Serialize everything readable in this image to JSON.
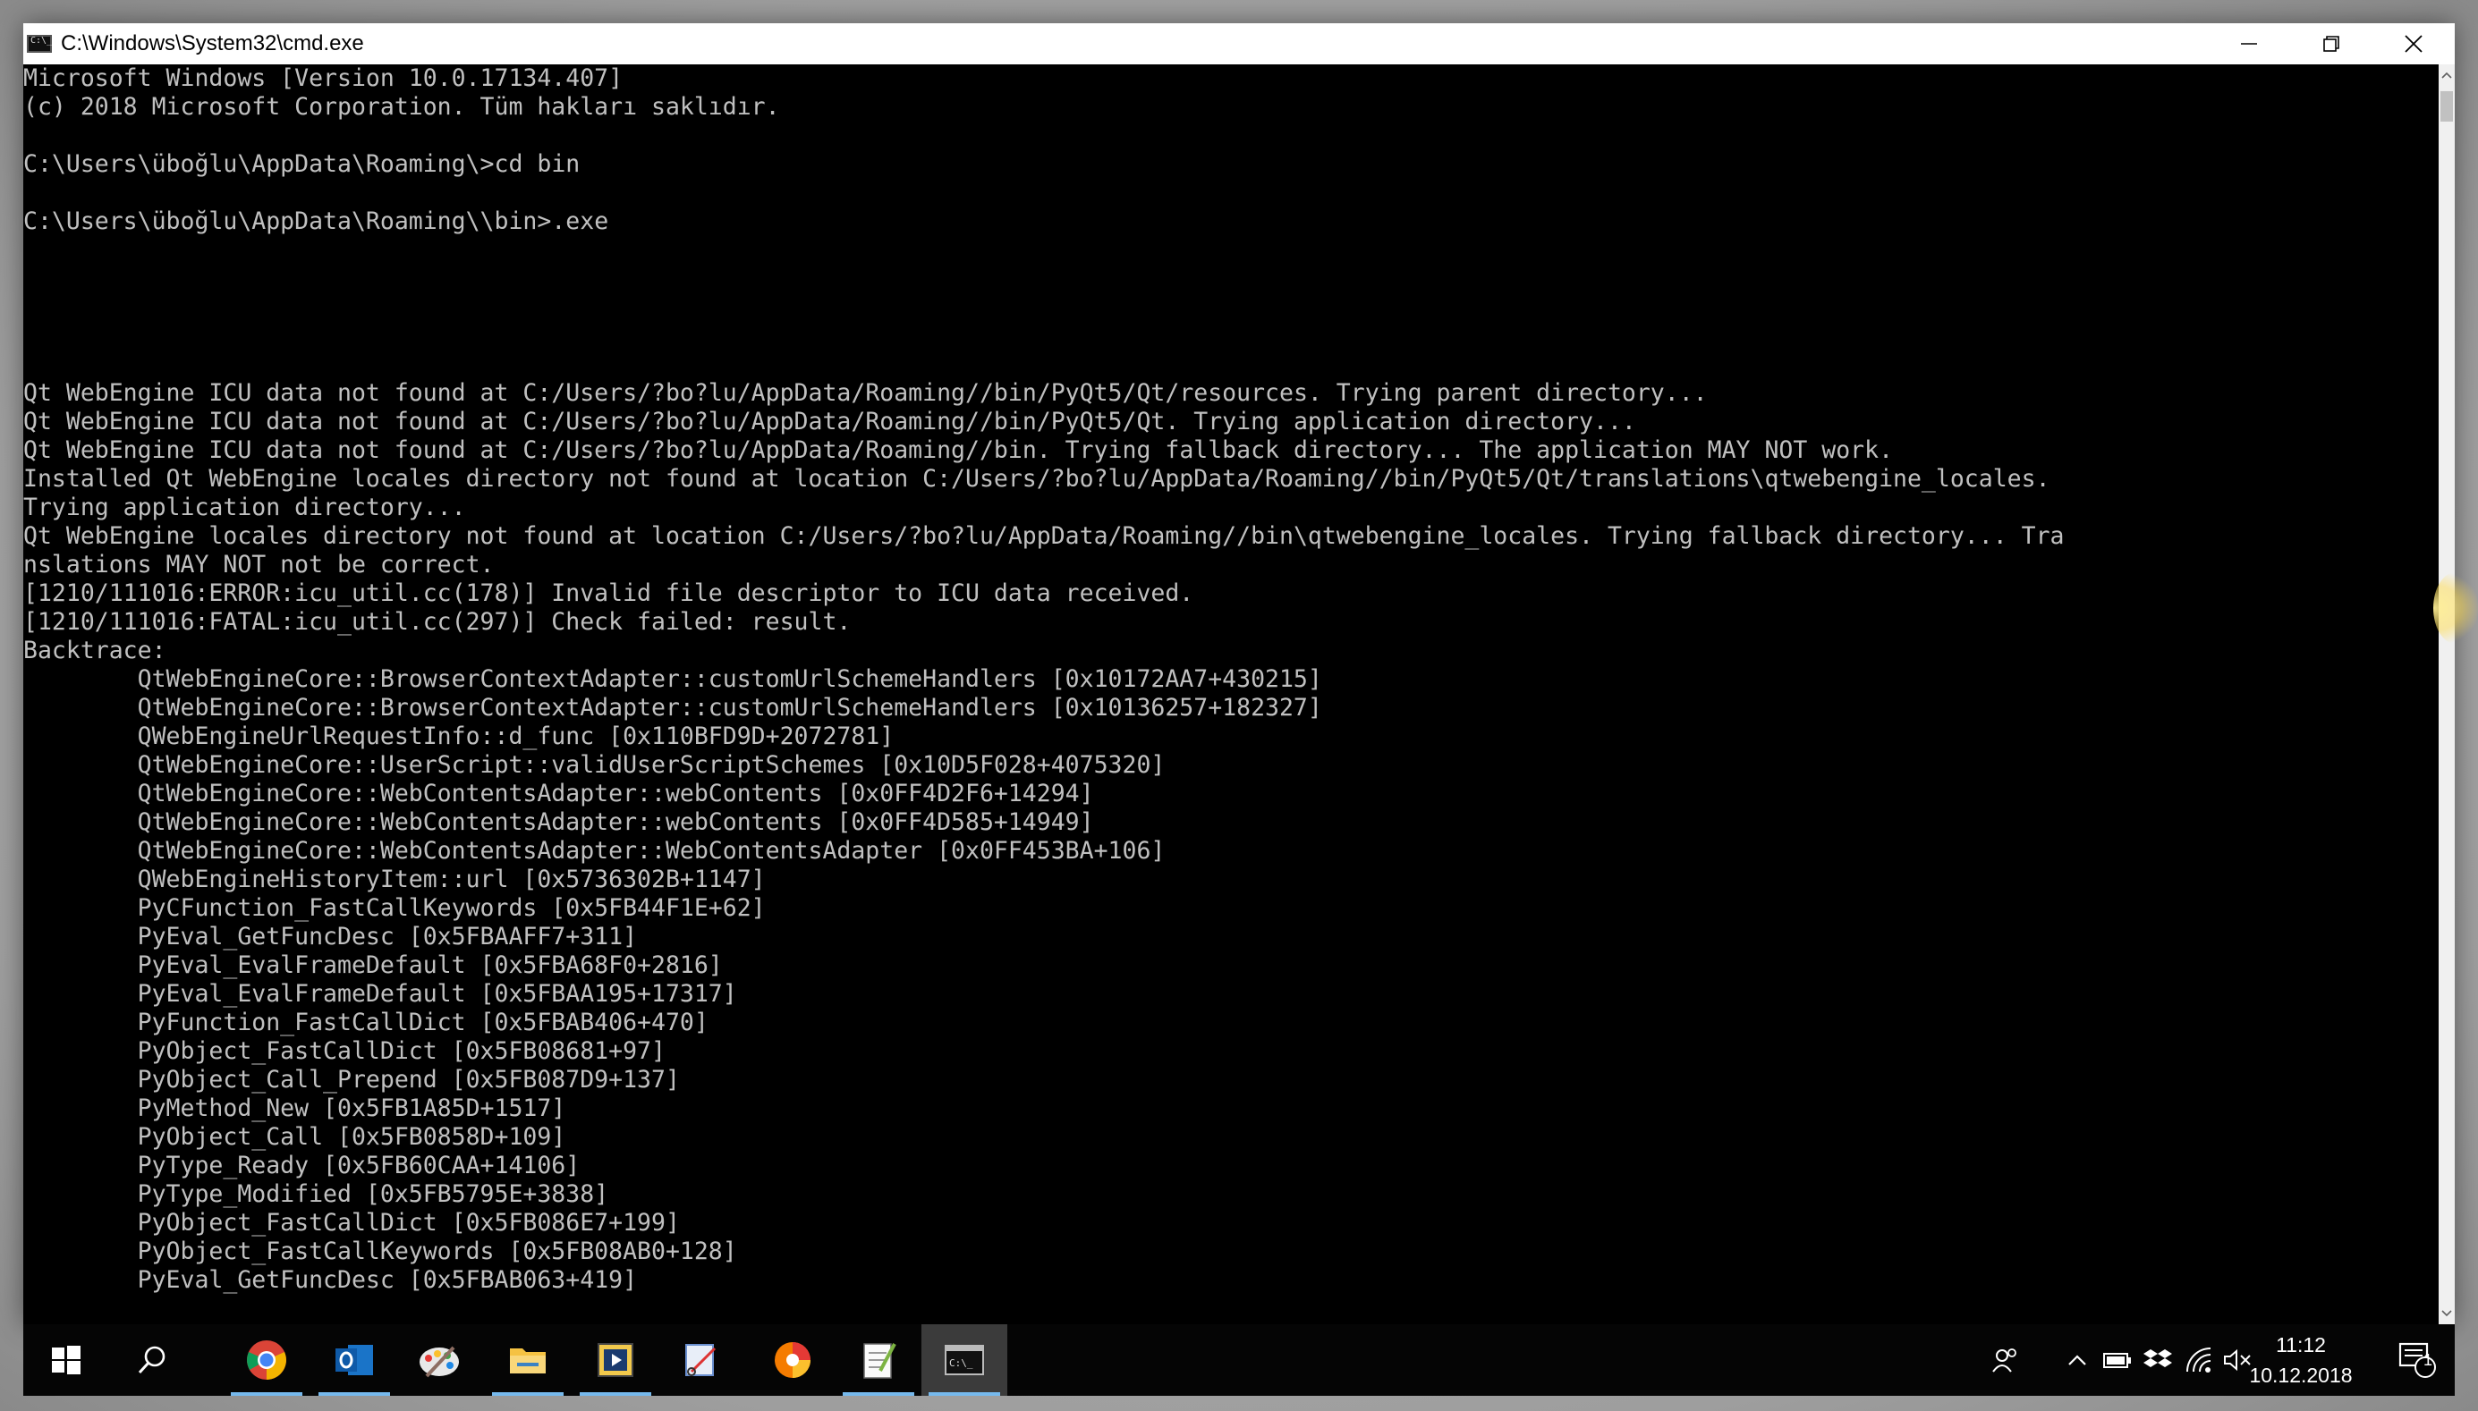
{
  "window": {
    "title": "C:\\Windows\\System32\\cmd.exe"
  },
  "console_lines": [
    {
      "segs": [
        {
          "t": "Microsoft Windows [Version 10.0.17134.407]"
        }
      ]
    },
    {
      "segs": [
        {
          "t": "(c) 2018 Microsoft Corporation. Tüm hakları saklıdır."
        }
      ]
    },
    {
      "segs": [
        {
          "t": ""
        }
      ]
    },
    {
      "segs": [
        {
          "t": "C:\\Users\\"
        },
        {
          "r": 11
        },
        {
          "t": "üboğlu\\AppData\\Roaming\\"
        },
        {
          "r": 12
        },
        {
          "t": ">cd bin"
        }
      ]
    },
    {
      "segs": [
        {
          "t": ""
        }
      ]
    },
    {
      "segs": [
        {
          "t": "C:\\Users\\"
        },
        {
          "r": 11
        },
        {
          "t": "üboğlu\\AppData\\Roaming\\"
        },
        {
          "r": 12
        },
        {
          "t": "\\bin>"
        },
        {
          "r": 12
        },
        {
          "t": ".exe"
        }
      ]
    },
    {
      "segs": [
        {
          "block": true
        }
      ]
    },
    {
      "segs": [
        {
          "t": ""
        }
      ]
    },
    {
      "segs": [
        {
          "t": ""
        }
      ]
    },
    {
      "segs": [
        {
          "t": "Qt WebEngine ICU data not found at C:/Users/"
        },
        {
          "r": 11
        },
        {
          "t": "?bo?lu/AppData/Roaming/"
        },
        {
          "r": 12
        },
        {
          "t": "/bin/PyQt5/Qt/resources. Trying parent directory..."
        }
      ]
    },
    {
      "segs": [
        {
          "t": "Qt WebEngine ICU data not found at C:/Users/"
        },
        {
          "r": 11
        },
        {
          "t": "?bo?lu/AppData/Roaming/"
        },
        {
          "r": 12
        },
        {
          "t": "/bin/PyQt5/Qt. Trying application directory..."
        }
      ]
    },
    {
      "segs": [
        {
          "t": "Qt WebEngine ICU data not found at C:/Users/"
        },
        {
          "r": 11
        },
        {
          "t": "?bo?lu/AppData/Roaming/"
        },
        {
          "r": 12
        },
        {
          "t": "/bin. Trying fallback directory... The application MAY NOT work."
        }
      ]
    },
    {
      "segs": [
        {
          "t": "Installed Qt WebEngine locales directory not found at location C:/Users/"
        },
        {
          "r": 11
        },
        {
          "t": "?bo?lu/AppData/Roaming/"
        },
        {
          "r": 12
        },
        {
          "t": "/bin/PyQt5/Qt/translations\\qtwebengine_locales."
        }
      ]
    },
    {
      "segs": [
        {
          "t": "Trying application directory..."
        }
      ]
    },
    {
      "segs": [
        {
          "t": "Qt WebEngine locales directory not found at location C:/Users/"
        },
        {
          "r": 11
        },
        {
          "t": "?bo?lu/AppData/Roaming/"
        },
        {
          "r": 12
        },
        {
          "t": "/bin\\qtwebengine_locales. Trying fallback directory... Tra"
        }
      ]
    },
    {
      "segs": [
        {
          "t": "nslations MAY NOT not be correct."
        }
      ]
    },
    {
      "segs": [
        {
          "t": "[1210/111016:ERROR:icu_util.cc(178)] Invalid file descriptor to ICU data received."
        }
      ]
    },
    {
      "segs": [
        {
          "t": "[1210/111016:FATAL:icu_util.cc(297)] Check failed: result."
        }
      ]
    },
    {
      "segs": [
        {
          "t": "Backtrace:"
        }
      ]
    },
    {
      "segs": [
        {
          "t": "        QtWebEngineCore::BrowserContextAdapter::customUrlSchemeHandlers [0x10172AA7+430215]"
        }
      ]
    },
    {
      "segs": [
        {
          "t": "        QtWebEngineCore::BrowserContextAdapter::customUrlSchemeHandlers [0x10136257+182327]"
        }
      ]
    },
    {
      "segs": [
        {
          "t": "        QWebEngineUrlRequestInfo::d_func [0x110BFD9D+2072781]"
        }
      ]
    },
    {
      "segs": [
        {
          "t": "        QtWebEngineCore::UserScript::validUserScriptSchemes [0x10D5F028+4075320]"
        }
      ]
    },
    {
      "segs": [
        {
          "t": "        QtWebEngineCore::WebContentsAdapter::webContents [0x0FF4D2F6+14294]"
        }
      ]
    },
    {
      "segs": [
        {
          "t": "        QtWebEngineCore::WebContentsAdapter::webContents [0x0FF4D585+14949]"
        }
      ]
    },
    {
      "segs": [
        {
          "t": "        QtWebEngineCore::WebContentsAdapter::WebContentsAdapter [0x0FF453BA+106]"
        }
      ]
    },
    {
      "segs": [
        {
          "t": "        QWebEngineHistoryItem::url [0x5736302B+1147]"
        }
      ]
    },
    {
      "segs": [
        {
          "t": "        PyCFunction_FastCallKeywords [0x5FB44F1E+62]"
        }
      ]
    },
    {
      "segs": [
        {
          "t": "        PyEval_GetFuncDesc [0x5FBAAFF7+311]"
        }
      ]
    },
    {
      "segs": [
        {
          "t": "        PyEval_EvalFrameDefault [0x5FBA68F0+2816]"
        }
      ]
    },
    {
      "segs": [
        {
          "t": "        PyEval_EvalFrameDefault [0x5FBAA195+17317]"
        }
      ]
    },
    {
      "segs": [
        {
          "t": "        PyFunction_FastCallDict [0x5FBAB406+470]"
        }
      ]
    },
    {
      "segs": [
        {
          "t": "        PyObject_FastCallDict [0x5FB08681+97]"
        }
      ]
    },
    {
      "segs": [
        {
          "t": "        PyObject_Call_Prepend [0x5FB087D9+137]"
        }
      ]
    },
    {
      "segs": [
        {
          "t": "        PyMethod_New [0x5FB1A85D+1517]"
        }
      ]
    },
    {
      "segs": [
        {
          "t": "        PyObject_Call [0x5FB0858D+109]"
        }
      ]
    },
    {
      "segs": [
        {
          "t": "        PyType_Ready [0x5FB60CAA+14106]"
        }
      ]
    },
    {
      "segs": [
        {
          "t": "        PyType_Modified [0x5FB5795E+3838]"
        }
      ]
    },
    {
      "segs": [
        {
          "t": "        PyObject_FastCallDict [0x5FB086E7+199]"
        }
      ]
    },
    {
      "segs": [
        {
          "t": "        PyObject_FastCallKeywords [0x5FB08AB0+128]"
        }
      ]
    },
    {
      "segs": [
        {
          "t": "        PyEval_GetFuncDesc [0x5FBAB063+419]"
        }
      ]
    }
  ],
  "taskbar": {
    "apps": [
      {
        "name": "start-button",
        "icon": "windows-logo"
      },
      {
        "name": "search-button",
        "icon": "search-icon"
      },
      {
        "name": "chrome",
        "icon": "chrome-icon"
      },
      {
        "name": "outlook",
        "icon": "outlook-icon"
      },
      {
        "name": "paint",
        "icon": "paint-icon"
      },
      {
        "name": "file-explorer",
        "icon": "folder-icon"
      },
      {
        "name": "media-player",
        "icon": "media-icon"
      },
      {
        "name": "snipping-tool",
        "icon": "snip-icon"
      },
      {
        "name": "app-orange",
        "icon": "orange-app-icon"
      },
      {
        "name": "notepad-plus",
        "icon": "notepad-icon"
      },
      {
        "name": "cmd",
        "icon": "cmd-icon"
      }
    ],
    "clock_time": "11:12",
    "clock_date": "10.12.2018",
    "notification_count": "1"
  },
  "colors": {
    "console_text": "#c0c0c0",
    "console_bg": "#000000",
    "taskbar_bg": "#050505",
    "active_underline": "#76b9ed"
  }
}
